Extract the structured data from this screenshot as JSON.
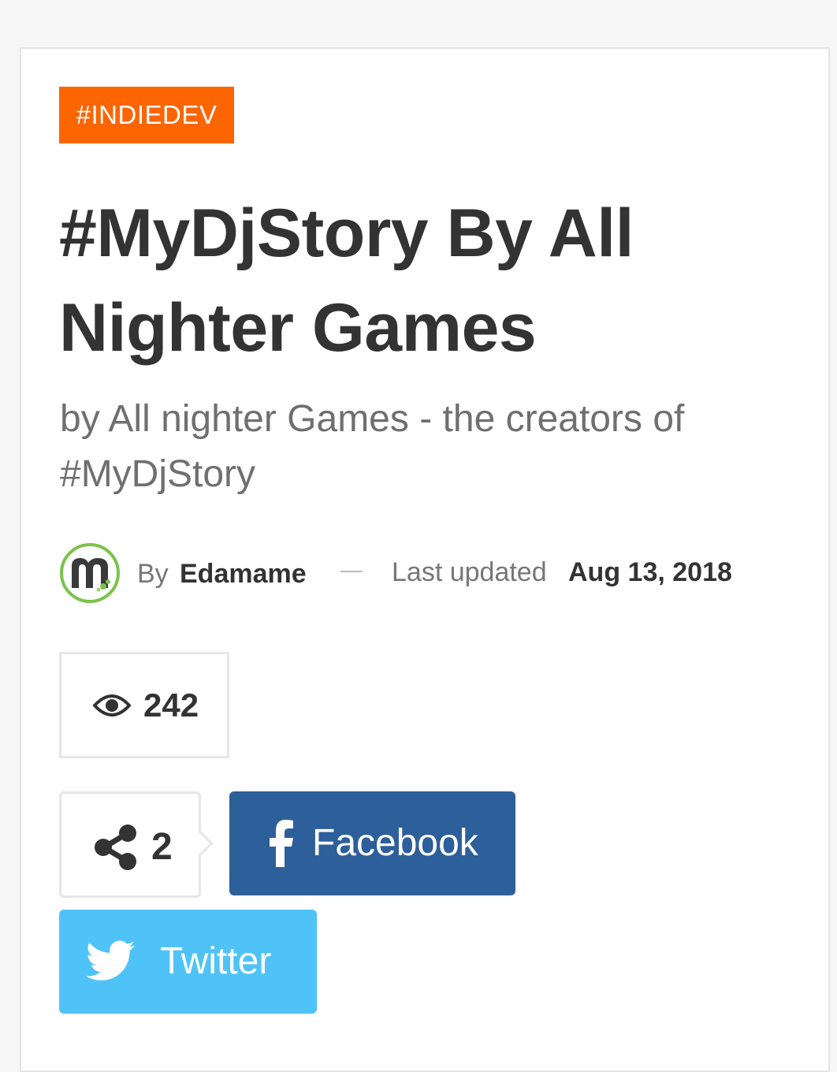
{
  "article": {
    "category_tag": "#INDIEDEV",
    "title": "#MyDjStory By All Nighter Games",
    "subtitle": "by All nighter Games - the creators of #MyDjStory"
  },
  "meta": {
    "by_label": "By",
    "author": "Edamame",
    "updated_label": "Last updated",
    "updated_date": "Aug 13, 2018"
  },
  "stats": {
    "views": "242",
    "shares": "2"
  },
  "share_buttons": {
    "facebook_label": "Facebook",
    "twitter_label": "Twitter"
  },
  "icons": {
    "views": "eye-icon",
    "shares": "share-icon",
    "facebook": "facebook-icon",
    "twitter": "twitter-bird-icon"
  },
  "colors": {
    "tag_background": "#fd6500",
    "facebook": "#2d5f9a",
    "twitter": "#4fc3f7",
    "title_text": "#333333",
    "subtitle_text": "#6f6f6f",
    "avatar_ring": "#7cc24a"
  }
}
